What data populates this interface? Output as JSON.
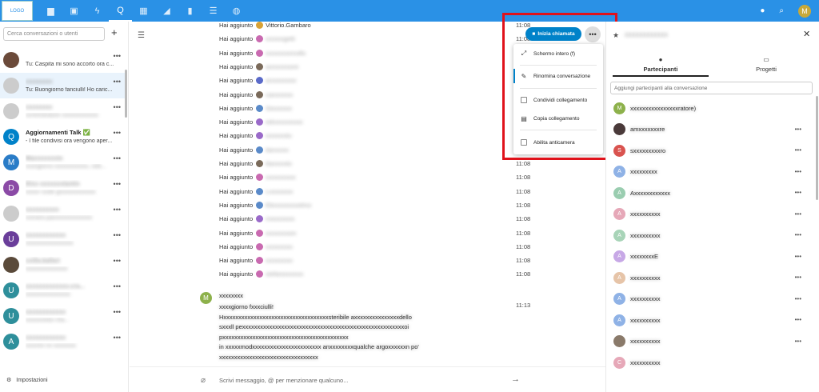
{
  "header": {
    "logo_text": "LOGO",
    "apps": [
      {
        "name": "files-icon",
        "glyph": "▆"
      },
      {
        "name": "photos-icon",
        "glyph": "▣"
      },
      {
        "name": "activity-icon",
        "glyph": "ϟ"
      },
      {
        "name": "talk-icon",
        "glyph": "Q"
      },
      {
        "name": "calendar-icon",
        "glyph": "▦"
      },
      {
        "name": "announcements-icon",
        "glyph": "◢"
      },
      {
        "name": "stats-icon",
        "glyph": "▮"
      },
      {
        "name": "tasks-icon",
        "glyph": "☰"
      },
      {
        "name": "globe-icon",
        "glyph": "◍"
      }
    ],
    "user_initial": "M"
  },
  "sidebar": {
    "search_placeholder": "Cerca conversazioni o utenti",
    "add_label": "+",
    "conversations": [
      {
        "name": "",
        "message": "Tu: Caspita mi sono accorto ora c...",
        "avatar_color": "#6b4a3a",
        "initial": ""
      },
      {
        "name": "xxxxxxxx",
        "message": "Tu: Buongiorno fanciulli! Ho caric...",
        "avatar_color": "#cccccc",
        "initial": ""
      },
      {
        "name": "xxxxxxxx",
        "message": "xxministratore xxxxxxxxxxxxx",
        "avatar_color": "#cccccc",
        "initial": ""
      },
      {
        "name": "Aggiornamenti Talk ✅",
        "message": "- I file condivisi ora vengono aper...",
        "avatar_color": "#0082c9",
        "initial": "Q"
      },
      {
        "name": "Maxxxxxxxio",
        "message": "xxongiorno xxxxxxxxxxxx, vole...",
        "avatar_color": "#2a7cc7",
        "initial": "M"
      },
      {
        "name": "Dixx xxxxxxxtantin",
        "message": "xxxxx vuole gxxxxxxxxxxxxx",
        "avatar_color": "#8b4aa6",
        "initial": "D"
      },
      {
        "name": "xxxxxxxxxx",
        "message": "xxxrano.paxxxxxxxxxxxxxx",
        "avatar_color": "#cccccc",
        "initial": ""
      },
      {
        "name": "xxxxxxxxxxxx",
        "message": "xxxxxxxxxxxxxxxxx",
        "avatar_color": "#6a3e9a",
        "initial": "U"
      },
      {
        "name": "xxilla.ballari",
        "message": "xxxxxxxxxxxxxxx",
        "avatar_color": "#5a4a3a",
        "initial": ""
      },
      {
        "name": "xxxxxxxxxxxxx.cra...",
        "message": "xxxxxxxxxxxxxxxx",
        "avatar_color": "#2e8f9b",
        "initial": "U"
      },
      {
        "name": "xxxxxxxxxxxx",
        "message": "xxxxxxxisto cha...",
        "avatar_color": "#2e8f9b",
        "initial": "U"
      },
      {
        "name": "xxxxxxxxxxxx",
        "message": "xxxxnio no xxxxxxxx",
        "avatar_color": "#2e8f9b",
        "initial": "A"
      }
    ],
    "settings_label": "Impostazioni"
  },
  "chat": {
    "system_rows": [
      {
        "text": "Hai aggiunto",
        "name": "Vittorio.Gambaro",
        "time": "11:08",
        "color": "#d8a236"
      },
      {
        "text": "Hai aggiunto",
        "name": "xxxxxxgetti",
        "time": "11:08",
        "color": "#c96ab0"
      },
      {
        "text": "Hai aggiunto",
        "name": "xxxxxxxxnnollo",
        "time": "11:08",
        "color": "#c96ab0"
      },
      {
        "text": "Hai aggiunto",
        "name": "axxxxxxxore",
        "time": "11:08",
        "color": "#7a6a5a"
      },
      {
        "text": "Hai aggiunto",
        "name": "anxxxxxxxx",
        "time": "11:08",
        "color": "#5a6ac9"
      },
      {
        "text": "Hai aggiunto",
        "name": "caxxxxxxx",
        "time": "11:08",
        "color": "#7a6a5a"
      },
      {
        "text": "Hai aggiunto",
        "name": "Sixxxxxxx",
        "time": "11:08",
        "color": "#5a8ac9"
      },
      {
        "text": "Hai aggiunto",
        "name": "edxxxxxxxxxo",
        "time": "11:08",
        "color": "#9a6ac9"
      },
      {
        "text": "Hai aggiunto",
        "name": "xxxxxxstu",
        "time": "11:08",
        "color": "#9a6ac9"
      },
      {
        "text": "Hai aggiunto",
        "name": "ilarxxxxx",
        "time": "11:08",
        "color": "#5a8ac9"
      },
      {
        "text": "Hai aggiunto",
        "name": "ilaxxxxxto",
        "time": "11:08",
        "color": "#7a6a5a"
      },
      {
        "text": "Hai aggiunto",
        "name": "xxxxxxxxxx",
        "time": "11:08",
        "color": "#c96ab0"
      },
      {
        "text": "Hai aggiunto",
        "name": "Lxxxxxxxx",
        "time": "11:08",
        "color": "#5a8ac9"
      },
      {
        "text": "Hai aggiunto",
        "name": "Elexxxxxxxxelmo",
        "time": "11:08",
        "color": "#5a8ac9"
      },
      {
        "text": "Hai aggiunto",
        "name": "mxxxxxxxx",
        "time": "11:08",
        "color": "#9a6ac9"
      },
      {
        "text": "Hai aggiunto",
        "name": "xxxxxxxxon",
        "time": "11:08",
        "color": "#c96ab0"
      },
      {
        "text": "Hai aggiunto",
        "name": "xxxxxxxxx",
        "time": "11:08",
        "color": "#c96ab0"
      },
      {
        "text": "Hai aggiunto",
        "name": "xxxxxxxxx",
        "time": "11:08",
        "color": "#c96ab0"
      },
      {
        "text": "Hai aggiunto",
        "name": "stefanoxxxxxx",
        "time": "11:08",
        "color": "#c96ab0"
      }
    ],
    "message": {
      "author": "xxxxxxxx",
      "author_initial": "M",
      "time": "11:13",
      "lines": [
        "xxxxgiorno fxxxciulli!",
        "Hxxxxxxxxxxxxxxxxxxxxxxxxxxxxxxxxxxxsteribile axxxxxxxxxxxxxxxdello",
        "sxxxll pexxxxxxxxxxxxxxxxxxxxxxxxxxxxxxxxxxxxxxxxxxxxxxxxxxxxxxoi",
        "pxxxxxxxxxxxxxxxxxxxxxxxxxxxxxxxxxxxxxxxxxx",
        "in xxxxxmodxxxxxxxxxxxxxxxxxxxxxxx anxxxxxxxxqualche argoxxxxxxn po'",
        "xxxxxxxxxxxxxxxxxxxxxxxxxxxxxxxxx"
      ]
    },
    "composer_placeholder": "Scrivi messaggio, @ per menzionare qualcuno..."
  },
  "call": {
    "start_label": "Inizia chiamata",
    "more_label": "•••"
  },
  "menu": {
    "fullscreen": "Schermo intero (f)",
    "rename": "Rinomina conversazione",
    "share_link": "Condividi collegamento",
    "copy_link": "Copia collegamento",
    "lobby": "Abilita anticamera"
  },
  "right": {
    "title": "xxxxxxxxxxxx",
    "tabs": {
      "participants": "Partecipanti",
      "projects": "Progetti"
    },
    "add_placeholder": "Aggiungi partecipanti alla conversazione",
    "participants": [
      {
        "name": "xxxxxxxxxxxxxxxxratore)",
        "initial": "M",
        "color": "#8db14b",
        "dots": false
      },
      {
        "name": "amxxxxxxxre",
        "initial": "",
        "color": "#4a3a3a",
        "dots": true
      },
      {
        "name": "sxxxxxxxxxro",
        "initial": "S",
        "color": "#d9534f",
        "dots": true
      },
      {
        "name": "xxxxxxxxx",
        "initial": "A",
        "color": "#8fb2e6",
        "dots": true
      },
      {
        "name": "Axxxxxxxxxxxx",
        "initial": "A",
        "color": "#9acdb0",
        "dots": true
      },
      {
        "name": "xxxxxxxxxx",
        "initial": "A",
        "color": "#e6a8b8",
        "dots": true
      },
      {
        "name": "xxxxxxxxxx",
        "initial": "A",
        "color": "#a8d4b8",
        "dots": true
      },
      {
        "name": "xxxxxxxxE",
        "initial": "A",
        "color": "#c7a8e6",
        "dots": true
      },
      {
        "name": "xxxxxxxxxx",
        "initial": "A",
        "color": "#e6c4a8",
        "dots": true
      },
      {
        "name": "xxxxxxxxxx",
        "initial": "A",
        "color": "#8fb2e6",
        "dots": true
      },
      {
        "name": "xxxxxxxxxx",
        "initial": "A",
        "color": "#8fb2e6",
        "dots": true
      },
      {
        "name": "xxxxxxxxxx",
        "initial": "",
        "color": "#8a7a6a",
        "dots": true
      },
      {
        "name": "xxxxxxxxxx",
        "initial": "C",
        "color": "#e6a8b8",
        "dots": false
      }
    ]
  }
}
